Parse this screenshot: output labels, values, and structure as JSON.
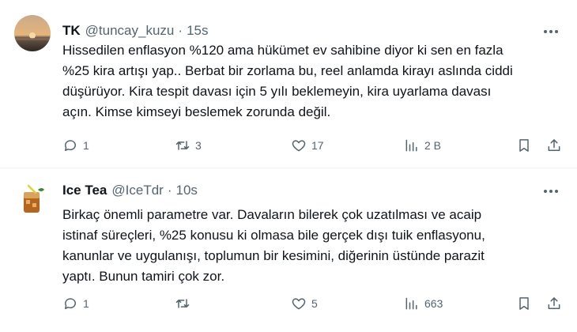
{
  "tweets": [
    {
      "name": "TK",
      "handle": "@tuncay_kuzu",
      "separator": "·",
      "time": "15s",
      "lines": [
        "Hissedilen enflasyon %120 ama hükümet ev sahibine diyor ki sen en fazla",
        "%25 kira artışı yap.. Berbat bir zorlama bu, reel anlamda kirayı aslında ciddi",
        "düşürüyor. Kira tespit davası için 5 yılı beklemeyin, kira uyarlama davası",
        "açın. Kimse kimseyi beslemek zorunda değil."
      ],
      "actions": {
        "replies": "1",
        "retweets": "3",
        "likes": "17",
        "views": "2 B"
      }
    },
    {
      "name": "Ice Tea",
      "handle": "@IceTdr",
      "separator": "·",
      "time": "10s",
      "lines": [
        "Birkaç önemli parametre var. Davaların bilerek çok uzatılması ve acaip",
        "istinaf süreçleri, %25 konusu ki olmasa bile gerçek dışı tuik enflasyonu,",
        "kanunlar ve uygulanışı, toplumun bir kesimini, diğerinin üstünde parazit",
        "yaptı.  Bunun tamiri çok zor."
      ],
      "actions": {
        "replies": "1",
        "retweets": "",
        "likes": "5",
        "views": "663"
      }
    }
  ],
  "icons": {
    "reply": "reply-icon",
    "retweet": "retweet-icon",
    "like": "heart-icon",
    "views": "views-icon",
    "bookmark": "bookmark-icon",
    "share": "share-icon",
    "more": "more-icon"
  },
  "colors": {
    "text_primary": "#0f1419",
    "text_secondary": "#536471",
    "divider": "#eff3f4"
  }
}
